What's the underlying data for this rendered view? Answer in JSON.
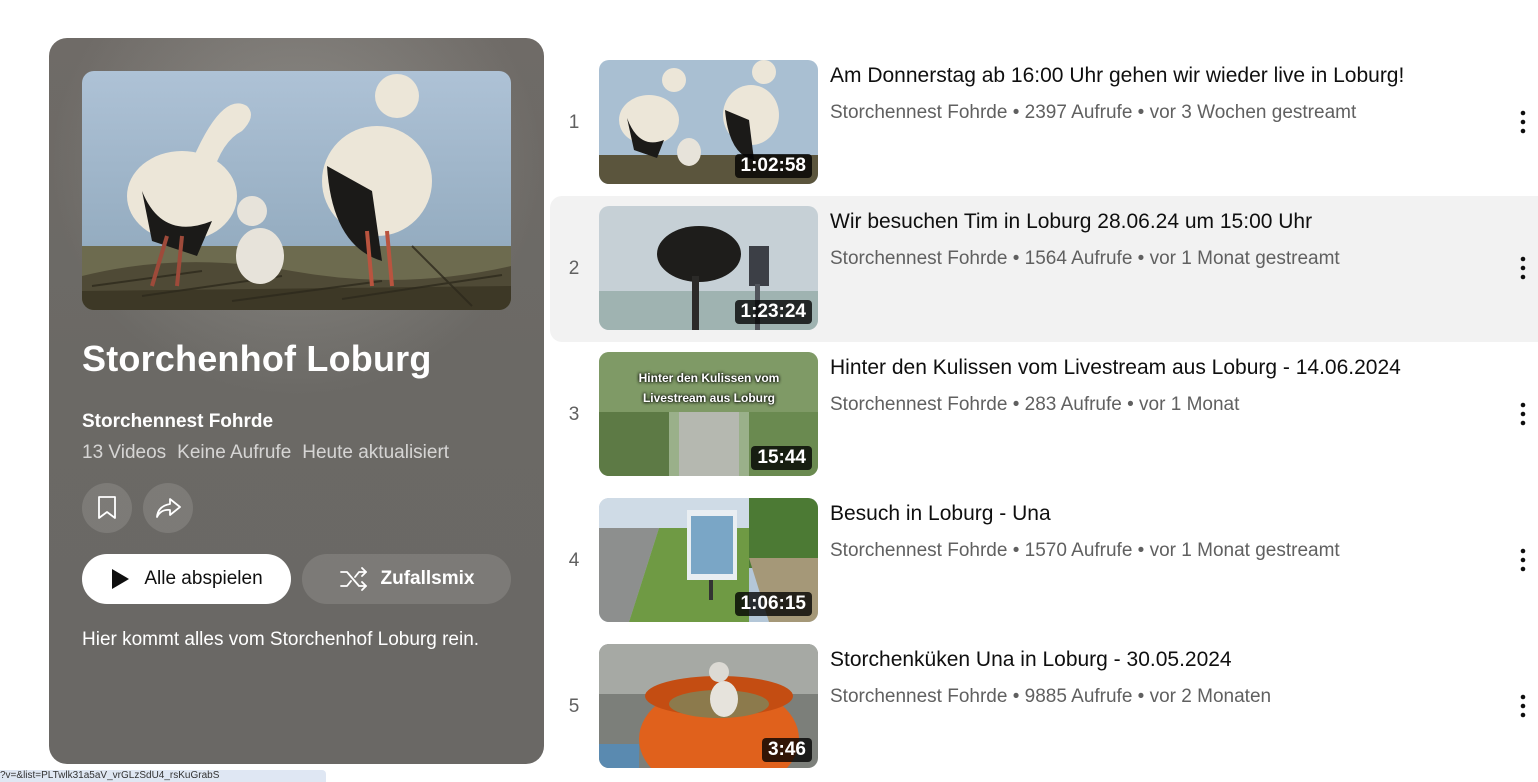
{
  "playlist": {
    "title": "Storchenhof Loburg",
    "owner": "Storchennest Fohrde",
    "video_count": "13 Videos",
    "views": "Keine Aufrufe",
    "updated": "Heute aktualisiert",
    "play_all_label": "Alle abspielen",
    "shuffle_label": "Zufallsmix",
    "description": "Hier kommt alles vom Storchenhof Loburg rein."
  },
  "videos": [
    {
      "index": "1",
      "title": "Am Donnerstag ab 16:00 Uhr gehen wir wieder live in Loburg!",
      "meta": "Storchennest Fohrde • 2397 Aufrufe • vor 3 Wochen gestreamt",
      "duration": "1:02:58"
    },
    {
      "index": "2",
      "title": "Wir besuchen Tim in Loburg 28.06.24 um 15:00 Uhr",
      "meta": "Storchennest Fohrde • 1564 Aufrufe • vor 1 Monat gestreamt",
      "duration": "1:23:24"
    },
    {
      "index": "3",
      "title": "Hinter den Kulissen vom Livestream aus Loburg - 14.06.2024",
      "meta": "Storchennest Fohrde • 283 Aufrufe • vor 1 Monat",
      "duration": "15:44",
      "thumb_text": "Hinter den Kulissen vom Livestream aus Loburg"
    },
    {
      "index": "4",
      "title": "Besuch in Loburg - Una",
      "meta": "Storchennest Fohrde • 1570 Aufrufe • vor 1 Monat gestreamt",
      "duration": "1:06:15"
    },
    {
      "index": "5",
      "title": "Storchenküken Una in Loburg - 30.05.2024",
      "meta": "Storchennest Fohrde • 9885 Aufrufe • vor 2 Monaten",
      "duration": "3:46"
    }
  ],
  "status_url": "?v=&list=PLTwlk31a5aV_vrGLzSdU4_rsKuGrabS"
}
